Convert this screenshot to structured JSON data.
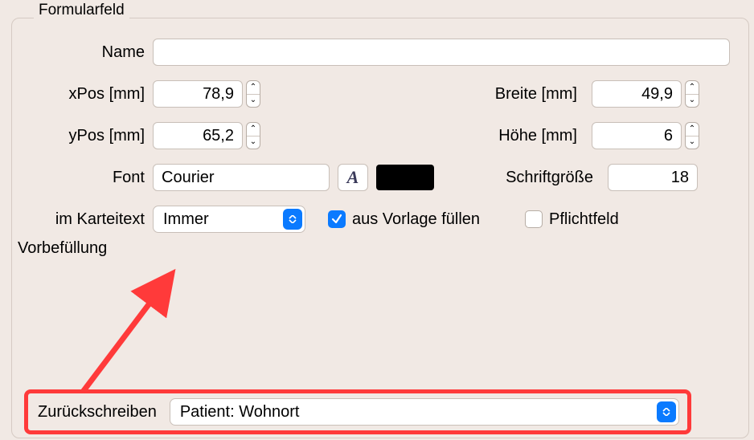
{
  "groupTitle": "Formularfeld",
  "labels": {
    "name": "Name",
    "xpos": "xPos [mm]",
    "ypos": "yPos [mm]",
    "width": "Breite [mm]",
    "height": "Höhe [mm]",
    "font": "Font",
    "fontSize": "Schriftgröße",
    "imKarteitext": "im Karteitext",
    "ausVorlage": "aus Vorlage füllen",
    "pflichtfeld": "Pflichtfeld",
    "vorbefuellung": "Vorbefüllung",
    "zurueckschreiben": "Zurückschreiben"
  },
  "values": {
    "name": "",
    "xpos": "78,9",
    "ypos": "65,2",
    "width": "49,9",
    "height": "6",
    "font": "Courier",
    "fontSize": "18",
    "imKarteitext": "Immer",
    "zurueckschreiben": "Patient: Wohnort",
    "ausVorlageChecked": true,
    "pflichtfeldChecked": false,
    "fontColor": "#000000"
  },
  "icons": {
    "fontGlyph": "A"
  },
  "annotationColor": "#ff3a3a",
  "accent": "#0a7aff"
}
